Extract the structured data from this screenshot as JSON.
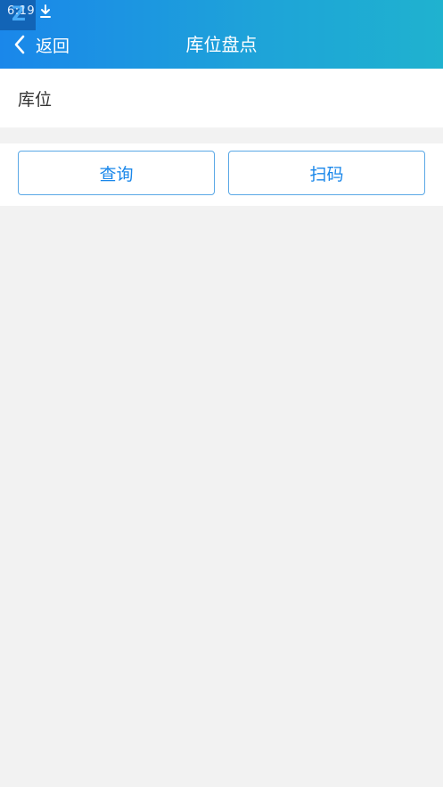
{
  "status_bar": {
    "time": "6:19",
    "badge_glyph": "Z",
    "icons": [
      "download-icon"
    ]
  },
  "header": {
    "back_label": "返回",
    "title": "库位盘点"
  },
  "form": {
    "location_label": "库位",
    "location_value": ""
  },
  "actions": {
    "query_label": "查询",
    "scan_label": "扫码"
  },
  "colors": {
    "header_gradient_start": "#1a87ea",
    "header_gradient_end": "#1fb2cf",
    "accent": "#1a87ea",
    "background": "#f2f2f2"
  }
}
